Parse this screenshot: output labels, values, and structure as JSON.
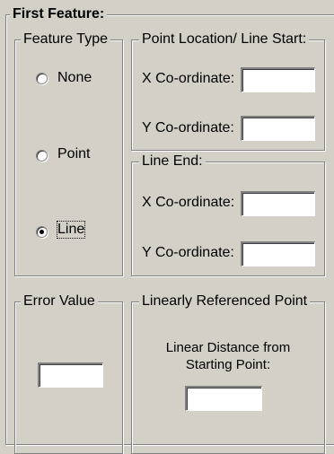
{
  "first_feature": {
    "title": "First Feature:",
    "feature_type": {
      "title": "Feature Type",
      "options": [
        {
          "label": "None",
          "checked": false
        },
        {
          "label": "Point",
          "checked": false
        },
        {
          "label": "Line",
          "checked": true
        }
      ]
    },
    "point_location": {
      "title": "Point Location/ Line Start:",
      "x_label": "X Co-ordinate:",
      "x_value": "",
      "y_label": "Y Co-ordinate:",
      "y_value": ""
    },
    "line_end": {
      "title": "Line End:",
      "x_label": "X Co-ordinate:",
      "x_value": "",
      "y_label": "Y Co-ordinate:",
      "y_value": ""
    },
    "error_value": {
      "title": "Error Value",
      "value": ""
    },
    "linear_ref": {
      "title": "Linearly Referenced Point",
      "desc_line1": "Linear Distance from",
      "desc_line2": "Starting Point:",
      "value": ""
    }
  }
}
